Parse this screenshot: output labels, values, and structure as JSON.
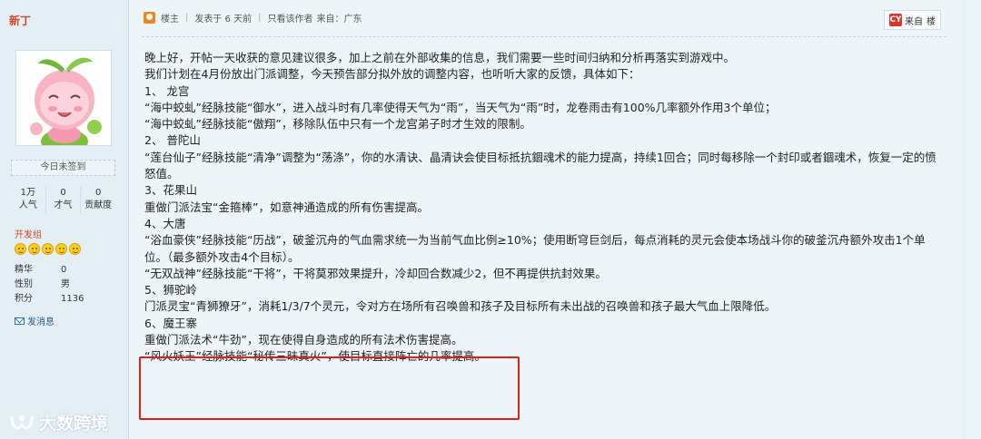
{
  "user": {
    "name": "新丁",
    "signin": "今日未签到",
    "stats": [
      {
        "value": "1万",
        "label": "人气"
      },
      {
        "value": "0",
        "label": "才气"
      },
      {
        "value": "0",
        "label": "贡献度"
      }
    ],
    "group": "开发组",
    "info": [
      {
        "key": "精华",
        "value": "0"
      },
      {
        "key": "性别",
        "value": "男"
      },
      {
        "key": "积分",
        "value": "1136"
      }
    ],
    "message": "发消息"
  },
  "post": {
    "owner_tag": "楼主",
    "posted": "发表于 6 天前",
    "only_author": "只看该作者",
    "source": "来自：广东",
    "from_button": "来自",
    "floor": "楼",
    "lines": [
      "晚上好，开帖一天收获的意见建议很多，加上之前在外部收集的信息，我们需要一些时间归纳和分析再落实到游戏中。",
      "我们计划在4月份放出门派调整，今天预告部分拟外放的调整内容，也听听大家的反馈，具体如下：",
      "1、 龙宫",
      "“海中蛟虬”经脉技能“御水”，进入战斗时有几率使得天气为“雨”，当天气为“雨”时，龙卷雨击有100%几率额外作用3个单位；",
      "“海中蛟虬”经脉技能“傲翔”，移除队伍中只有一个龙宫弟子时才生效的限制。",
      "2、 普陀山",
      "“莲台仙子”经脉技能“清净”调整为“荡涤”，你的水清诀、晶清诀会使目标抵抗錮魂术的能力提高，持续1回合；同时每移除一个封印或者錮魂术，恢复一定的愤怒值。",
      "3、花果山",
      "重做门派法宝“金箍棒”，如意神通造成的所有伤害提高。",
      "4、大唐",
      "“浴血豪侠”经脉技能“历战”，破釜沉舟的气血需求统一为当前气血比例≥10%；使用断穹巨剑后，每点消耗的灵元会使本场战斗你的破釜沉舟额外攻击1个单位。（最多额外攻击4个目标）。",
      "“无双战神”经脉技能“干将”，干将莫邪效果提升，冷却回合数减少2，但不再提供抗封效果。",
      "5、狮驼岭",
      "门派灵宝“青狮獠牙”，消耗1/3/7个灵元，令对方在场所有召唤兽和孩子及目标所有未出战的召唤兽和孩子最大气血上限降低。",
      "6、魔王寨",
      "重做门派法术“牛劲”，现在使得自身造成的所有法术伤害提高。",
      "“风火妖王”经脉技能“秘传三昧真火”，使目标直接阵亡的几率提高。"
    ]
  },
  "watermark": "大数跨境",
  "colors": {
    "highlight": "#e1201c",
    "username": "#d8432b"
  }
}
